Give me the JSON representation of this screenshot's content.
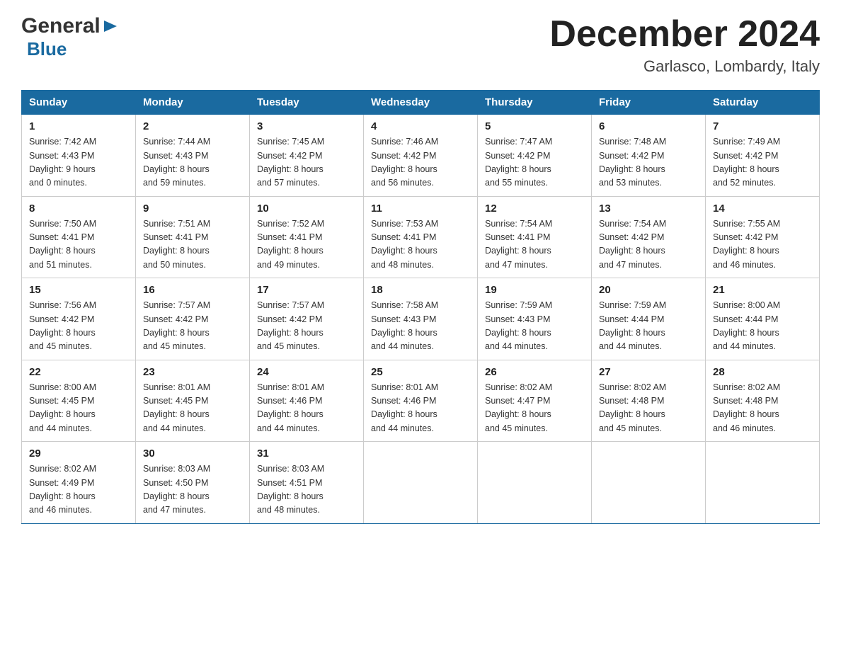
{
  "header": {
    "logo_general": "General",
    "logo_blue": "Blue",
    "month_title": "December 2024",
    "location": "Garlasco, Lombardy, Italy"
  },
  "weekdays": [
    "Sunday",
    "Monday",
    "Tuesday",
    "Wednesday",
    "Thursday",
    "Friday",
    "Saturday"
  ],
  "weeks": [
    [
      {
        "day": "1",
        "sunrise": "7:42 AM",
        "sunset": "4:43 PM",
        "daylight": "9 hours and 0 minutes."
      },
      {
        "day": "2",
        "sunrise": "7:44 AM",
        "sunset": "4:43 PM",
        "daylight": "8 hours and 59 minutes."
      },
      {
        "day": "3",
        "sunrise": "7:45 AM",
        "sunset": "4:42 PM",
        "daylight": "8 hours and 57 minutes."
      },
      {
        "day": "4",
        "sunrise": "7:46 AM",
        "sunset": "4:42 PM",
        "daylight": "8 hours and 56 minutes."
      },
      {
        "day": "5",
        "sunrise": "7:47 AM",
        "sunset": "4:42 PM",
        "daylight": "8 hours and 55 minutes."
      },
      {
        "day": "6",
        "sunrise": "7:48 AM",
        "sunset": "4:42 PM",
        "daylight": "8 hours and 53 minutes."
      },
      {
        "day": "7",
        "sunrise": "7:49 AM",
        "sunset": "4:42 PM",
        "daylight": "8 hours and 52 minutes."
      }
    ],
    [
      {
        "day": "8",
        "sunrise": "7:50 AM",
        "sunset": "4:41 PM",
        "daylight": "8 hours and 51 minutes."
      },
      {
        "day": "9",
        "sunrise": "7:51 AM",
        "sunset": "4:41 PM",
        "daylight": "8 hours and 50 minutes."
      },
      {
        "day": "10",
        "sunrise": "7:52 AM",
        "sunset": "4:41 PM",
        "daylight": "8 hours and 49 minutes."
      },
      {
        "day": "11",
        "sunrise": "7:53 AM",
        "sunset": "4:41 PM",
        "daylight": "8 hours and 48 minutes."
      },
      {
        "day": "12",
        "sunrise": "7:54 AM",
        "sunset": "4:41 PM",
        "daylight": "8 hours and 47 minutes."
      },
      {
        "day": "13",
        "sunrise": "7:54 AM",
        "sunset": "4:42 PM",
        "daylight": "8 hours and 47 minutes."
      },
      {
        "day": "14",
        "sunrise": "7:55 AM",
        "sunset": "4:42 PM",
        "daylight": "8 hours and 46 minutes."
      }
    ],
    [
      {
        "day": "15",
        "sunrise": "7:56 AM",
        "sunset": "4:42 PM",
        "daylight": "8 hours and 45 minutes."
      },
      {
        "day": "16",
        "sunrise": "7:57 AM",
        "sunset": "4:42 PM",
        "daylight": "8 hours and 45 minutes."
      },
      {
        "day": "17",
        "sunrise": "7:57 AM",
        "sunset": "4:42 PM",
        "daylight": "8 hours and 45 minutes."
      },
      {
        "day": "18",
        "sunrise": "7:58 AM",
        "sunset": "4:43 PM",
        "daylight": "8 hours and 44 minutes."
      },
      {
        "day": "19",
        "sunrise": "7:59 AM",
        "sunset": "4:43 PM",
        "daylight": "8 hours and 44 minutes."
      },
      {
        "day": "20",
        "sunrise": "7:59 AM",
        "sunset": "4:44 PM",
        "daylight": "8 hours and 44 minutes."
      },
      {
        "day": "21",
        "sunrise": "8:00 AM",
        "sunset": "4:44 PM",
        "daylight": "8 hours and 44 minutes."
      }
    ],
    [
      {
        "day": "22",
        "sunrise": "8:00 AM",
        "sunset": "4:45 PM",
        "daylight": "8 hours and 44 minutes."
      },
      {
        "day": "23",
        "sunrise": "8:01 AM",
        "sunset": "4:45 PM",
        "daylight": "8 hours and 44 minutes."
      },
      {
        "day": "24",
        "sunrise": "8:01 AM",
        "sunset": "4:46 PM",
        "daylight": "8 hours and 44 minutes."
      },
      {
        "day": "25",
        "sunrise": "8:01 AM",
        "sunset": "4:46 PM",
        "daylight": "8 hours and 44 minutes."
      },
      {
        "day": "26",
        "sunrise": "8:02 AM",
        "sunset": "4:47 PM",
        "daylight": "8 hours and 45 minutes."
      },
      {
        "day": "27",
        "sunrise": "8:02 AM",
        "sunset": "4:48 PM",
        "daylight": "8 hours and 45 minutes."
      },
      {
        "day": "28",
        "sunrise": "8:02 AM",
        "sunset": "4:48 PM",
        "daylight": "8 hours and 46 minutes."
      }
    ],
    [
      {
        "day": "29",
        "sunrise": "8:02 AM",
        "sunset": "4:49 PM",
        "daylight": "8 hours and 46 minutes."
      },
      {
        "day": "30",
        "sunrise": "8:03 AM",
        "sunset": "4:50 PM",
        "daylight": "8 hours and 47 minutes."
      },
      {
        "day": "31",
        "sunrise": "8:03 AM",
        "sunset": "4:51 PM",
        "daylight": "8 hours and 48 minutes."
      },
      null,
      null,
      null,
      null
    ]
  ],
  "labels": {
    "sunrise": "Sunrise:",
    "sunset": "Sunset:",
    "daylight": "Daylight:"
  }
}
